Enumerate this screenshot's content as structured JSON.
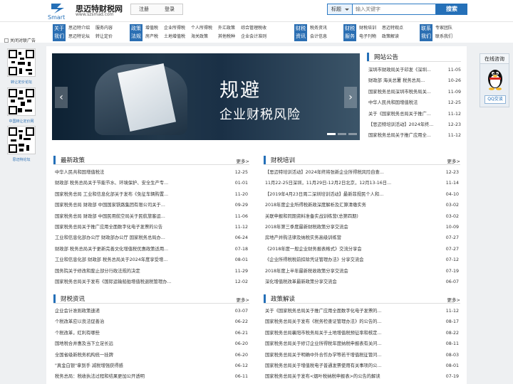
{
  "header": {
    "logo_text": "Smart",
    "site_name": "思迈特财税网",
    "site_url": "www.szsmad.com",
    "register_label": "注册",
    "login_label": "登录",
    "search_type": "标题",
    "search_placeholder": "输入关键字",
    "search_button": "搜索"
  },
  "nav": [
    {
      "head": [
        "关于",
        "我们"
      ],
      "items": [
        "思迈特介绍",
        "思迈特论坛",
        "服务内容",
        "转让定价"
      ]
    },
    {
      "head": [
        "政策",
        "法规"
      ],
      "items": [
        "增值税",
        "房产税",
        "企业所得税",
        "土地增值税",
        "个人所得税",
        "海关政策",
        "外汇政策",
        "其他税种",
        "综合管理税收",
        "企业会计准则"
      ]
    },
    {
      "head": [
        "财税",
        "资讯"
      ],
      "items": [
        "税务资讯",
        "会计信息"
      ]
    },
    {
      "head": [
        "财税",
        "服务"
      ],
      "items": [
        "财税培训",
        "电子刊物",
        "思迈特观点",
        "政策解读"
      ]
    },
    {
      "head": [
        "联系",
        "我们"
      ],
      "items": [
        "专家团队",
        "联系我们"
      ]
    }
  ],
  "left_ad": {
    "broken_alt": "关闭对联广告",
    "qr_captions": [
      "转让定价论坛",
      "中国转让定价网",
      "思迈特论坛"
    ]
  },
  "banner": {
    "line1": "规避",
    "line2": "企业财税风险",
    "prev": "‹",
    "next": "›"
  },
  "announcements": {
    "title": "网站公告",
    "items": [
      {
        "t": "深圳市财政局关于印发《深圳...",
        "d": "11-05"
      },
      {
        "t": "财政部 海关总署 税务总局...",
        "d": "10-26"
      },
      {
        "t": "国家税务总局深圳市税务局关...",
        "d": "11-09"
      },
      {
        "t": "中华人民共和国增值税法",
        "d": "12-25"
      },
      {
        "t": "关于《国家税务总局关于推广...",
        "d": "11-12"
      },
      {
        "t": "【思迈特培训活动】2024年终...",
        "d": "12-23"
      },
      {
        "t": "国家税务总局关于推广应用全...",
        "d": "11-12"
      }
    ]
  },
  "latest_policy": {
    "title": "最新政策",
    "more": "更多>",
    "items": [
      {
        "t": "中华人民共和国增值税法",
        "d": "12-25"
      },
      {
        "t": "财政部 税务总局关于节能节水、环境保护、安全生产专...",
        "d": "01-01"
      },
      {
        "t": "国家税务总局 工业和信息化部关于发布《免征车辆购置...",
        "d": "11-20"
      },
      {
        "t": "国家税务总局 财政部 中国国家铁路集团有限公司关于...",
        "d": "09-29"
      },
      {
        "t": "国家税务总局 财政部 中国民用航空局关于民航旅客运...",
        "d": "11-06"
      },
      {
        "t": "国家税务总局关于推广应用全面数字化电子发票的公告",
        "d": "11-12"
      },
      {
        "t": "工业和信息化部办公厅 财政部办公厅 国家税务总局办...",
        "d": "06-24"
      },
      {
        "t": "财政部 税务总局关于更新完善文化增值税优惠政策适用...",
        "d": "07-18"
      },
      {
        "t": "工业和信息化部 财政部 税务总局关于2024年度享受增...",
        "d": "08-01"
      },
      {
        "t": "国务院关于修改和废止部分行政法规的决定",
        "d": "11-29"
      },
      {
        "t": "国家税务总局关于发布《国际运输船舶增值税退税管理办...",
        "d": "12-02"
      }
    ]
  },
  "tax_training": {
    "title": "财税培训",
    "more": "更多>",
    "items": [
      {
        "t": "【思迈特培训活动】2024年终将张新企业所得税风险自查...",
        "d": "12-23"
      },
      {
        "t": "11月22-25日深圳，11月29日-12月2日北京，12月13-16日...",
        "d": "11-14"
      },
      {
        "t": "【2019年4月23日周二深圳培训活动】最新菲规民个人和...",
        "d": "04-10"
      },
      {
        "t": "2018年度企业所得税新政深度解析及汇算清缴实务",
        "d": "03-02"
      },
      {
        "t": "关联申报和同期资料准备实战训练营(总第四期)",
        "d": "03-02"
      },
      {
        "t": "2018年第三季度最新财税政策分享交流会",
        "d": "10-09"
      },
      {
        "t": "房地产并购法律及纳税实务高级训练营",
        "d": "07-27"
      },
      {
        "t": "《2018年度一般企业财务报表格式》交流分享会",
        "d": "07-27"
      },
      {
        "t": "《企业所得税税前扣除凭证管理办法》分享交流会",
        "d": "07-12"
      },
      {
        "t": "2018年度上半年最新税收政策分享交流会",
        "d": "07-19"
      },
      {
        "t": "深化增值税改革最新政策分享交流会",
        "d": "06-07"
      }
    ]
  },
  "tax_news": {
    "title": "财税资讯",
    "more": "更多>",
    "items": [
      {
        "t": "企业会计准则政策速递",
        "d": "03-07"
      },
      {
        "t": "个税改革应以良法促善治",
        "d": "06-22"
      },
      {
        "t": "个税改革，红利有哪些",
        "d": "06-21"
      },
      {
        "t": "国地税合并惠及当下立足长远",
        "d": "06-20"
      },
      {
        "t": "全国省级新税务机构统一挂牌",
        "d": "06-20"
      },
      {
        "t": "\"真金白银\"拿到手 减税增强获得感",
        "d": "06-12"
      },
      {
        "t": "税务总局：税收执法过程和结果更加公开透明",
        "d": "06-11"
      }
    ]
  },
  "policy_interpretation": {
    "title": "政策解读",
    "more": "更多>",
    "items": [
      {
        "t": "关于《国家税务总局关于推广应用全面数字化电子发票的...",
        "d": "11-12"
      },
      {
        "t": "国家税务总局关于发布《税务检查证管理办法》的公告的...",
        "d": "08-17"
      },
      {
        "t": "国家税务总局襄阳市税务局关于土地增值税预征率和核定...",
        "d": "08-22"
      },
      {
        "t": "国家税务总局关于修订企业所得税年度纳税申报表有关问...",
        "d": "08-11"
      },
      {
        "t": "国家税务总局关于明确中外合作办学等若干增值税征管问...",
        "d": "08-03"
      },
      {
        "t": "国家税务总局关于增值税电子普通发票使用有关事项的公...",
        "d": "08-01"
      },
      {
        "t": "国家税务总局关于发布<烟叶税纳税申报表>的公告的解读",
        "d": "07-19"
      }
    ]
  },
  "float_service": {
    "title": "在线咨询",
    "button": "QQ交谈"
  }
}
